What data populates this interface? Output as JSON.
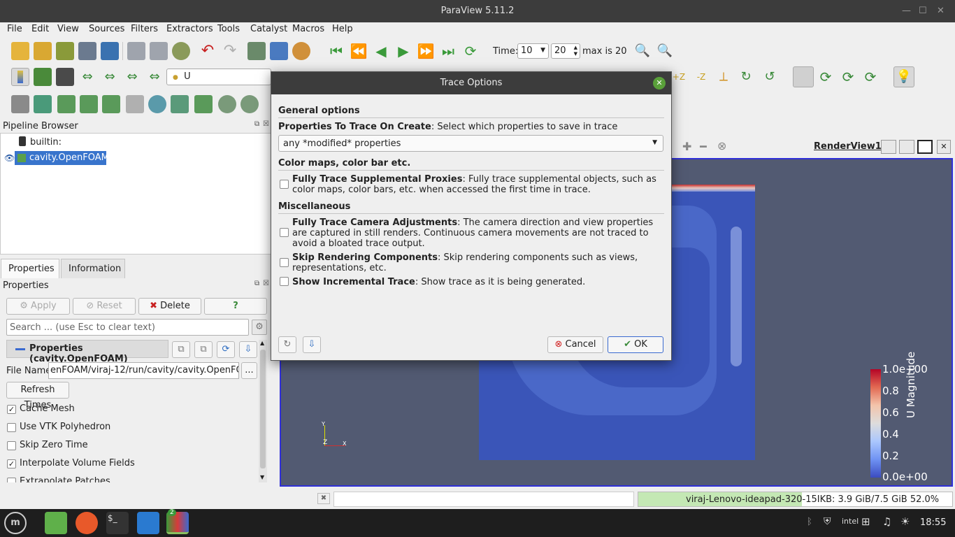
{
  "window": {
    "title": "ParaView 5.11.2"
  },
  "menu": [
    "File",
    "Edit",
    "View",
    "Sources",
    "Filters",
    "Extractors",
    "Tools",
    "Catalyst",
    "Macros",
    "Help"
  ],
  "time": {
    "label": "Time:",
    "value": "10",
    "index": "20",
    "max_label": "max is 20"
  },
  "toolbar2": {
    "array_value": "U"
  },
  "pipeline": {
    "title": "Pipeline Browser",
    "items": [
      {
        "label": "builtin:"
      },
      {
        "label": "cavity.OpenFOAM"
      }
    ]
  },
  "properties": {
    "tabs": [
      "Properties",
      "Information"
    ],
    "title": "Properties",
    "apply": "Apply",
    "reset": "Reset",
    "delete": "Delete",
    "help": "?",
    "search_placeholder": "Search ... (use Esc to clear text)",
    "section": "Properties (cavity.OpenFOAM)",
    "file_name_label": "File Name",
    "file_name_value": "enFOAM/viraj-12/run/cavity/cavity.OpenFOAM",
    "browse": "...",
    "refresh_times": "Refresh Times",
    "options": [
      {
        "label": "Cache Mesh",
        "checked": true
      },
      {
        "label": "Use VTK Polyhedron",
        "checked": false
      },
      {
        "label": "Skip Zero Time",
        "checked": false
      },
      {
        "label": "Interpolate Volume Fields",
        "checked": true
      },
      {
        "label": "Extrapolate Patches",
        "checked": false
      }
    ]
  },
  "view": {
    "name": "RenderView1"
  },
  "colorbar": {
    "title": "U Magnitude",
    "ticks": [
      "1.0e+00",
      "0.8",
      "0.6",
      "0.4",
      "0.2",
      "0.0e+00"
    ]
  },
  "axes": {
    "y": "Y",
    "z": "Z",
    "x": "X"
  },
  "dialog": {
    "title": "Trace Options",
    "general_header": "General options",
    "prop_bold": "Properties To Trace On Create",
    "prop_desc": ": Select which properties to save in trace",
    "prop_select": "any *modified* properties",
    "color_header": "Color maps, color bar etc.",
    "supp_bold": "Fully Trace Supplemental Proxies",
    "supp_desc": ": Fully trace supplemental objects, such as color maps, color bars, etc. when accessed the first time in trace.",
    "misc_header": "Miscellaneous",
    "cam_bold": "Fully Trace Camera Adjustments",
    "cam_desc": ": The camera direction and view properties are captured in still renders. Continuous camera movements are not traced to avoid a bloated trace output.",
    "skip_bold": "Skip Rendering Components",
    "skip_desc": ": Skip rendering components such as views, representations, etc.",
    "inc_bold": "Show Incremental Trace",
    "inc_desc": ": Show trace as it is being generated.",
    "cancel": "Cancel",
    "ok": "OK"
  },
  "status": {
    "memory": "viraj-Lenovo-ideapad-320-15IKB: 3.9 GiB/7.5 GiB 52.0%"
  },
  "taskbar": {
    "clock": "18:55",
    "badge": "2"
  }
}
